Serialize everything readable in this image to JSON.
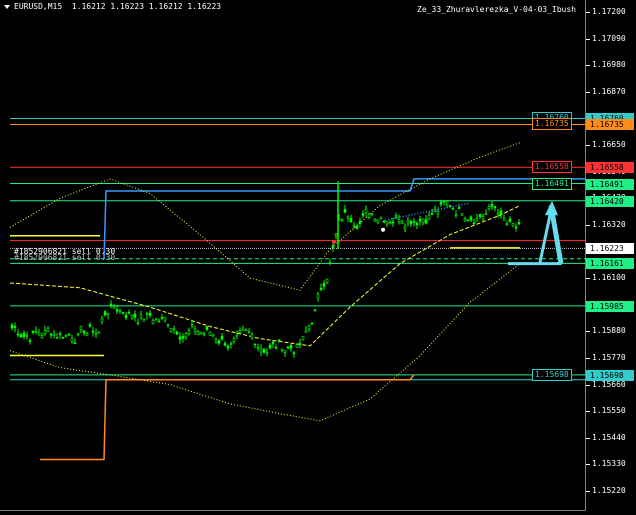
{
  "header": {
    "symbol": "EURUSD,M15",
    "prices": "1.16212 1.16223 1.16212 1.16223",
    "indicator": "Ze_33_Zhuravlerezka_V-04-03_Ibush"
  },
  "order_label": "#1852906821 sell 0.30",
  "order_label_dup": "#1852906821 sell 0.30",
  "axis": {
    "ticks": [
      "1.17200",
      "1.17090",
      "1.16980",
      "1.16870",
      "1.16760",
      "1.16650",
      "1.16540",
      "1.16430",
      "1.16320",
      "1.16210",
      "1.16100",
      "1.15990",
      "1.15880",
      "1.15770",
      "1.15660",
      "1.15550",
      "1.15440",
      "1.15330",
      "1.15220"
    ],
    "price_boxes": [
      {
        "value": "1.16760",
        "color": "#33cccc"
      },
      {
        "value": "1.16735",
        "color": "#ff8c1a"
      },
      {
        "value": "1.16558",
        "color": "#ff3333"
      },
      {
        "value": "1.16491",
        "color": "#22ee88"
      },
      {
        "value": "1.16420",
        "color": "#22ee88"
      },
      {
        "value": "1.16223",
        "color": "#ffffff"
      },
      {
        "value": "1.16161",
        "color": "#22ee88"
      },
      {
        "value": "1.15985",
        "color": "#22ee88"
      },
      {
        "value": "1.15700",
        "color": "#22ee88"
      },
      {
        "value": "1.15698",
        "color": "#33cccc"
      }
    ]
  },
  "in_chart_labels": [
    {
      "value": "1.16760",
      "color": "#33cccc"
    },
    {
      "value": "1.16735",
      "color": "#ff8c1a"
    },
    {
      "value": "1.16558",
      "color": "#ff3333"
    },
    {
      "value": "1.16491",
      "color": "#22ee88"
    },
    {
      "value": "1.15698",
      "color": "#33cccc"
    }
  ],
  "colors": {
    "background": "#000000",
    "candle": "#00ff00",
    "cyan": "#33cccc",
    "orange": "#ff8c1a",
    "red": "#ff3333",
    "green_line": "#22ee88",
    "yellow": "#ffff33",
    "blue": "#3399ff",
    "arrow": "#66ddee"
  }
}
